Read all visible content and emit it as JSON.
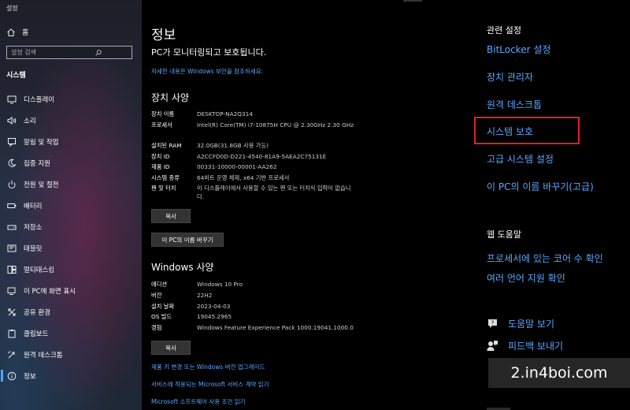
{
  "app_title": "설정",
  "home_label": "홈",
  "search_placeholder": "설정 검색",
  "section_label": "시스템",
  "nav": [
    {
      "label": "디스플레이",
      "icon": "display-icon"
    },
    {
      "label": "소리",
      "icon": "sound-icon"
    },
    {
      "label": "알림 및 작업",
      "icon": "notification-icon"
    },
    {
      "label": "집중 지원",
      "icon": "moon-icon"
    },
    {
      "label": "전원 및 절전",
      "icon": "power-icon"
    },
    {
      "label": "배터리",
      "icon": "battery-icon"
    },
    {
      "label": "저장소",
      "icon": "storage-icon"
    },
    {
      "label": "태블릿",
      "icon": "tablet-icon"
    },
    {
      "label": "멀티태스킹",
      "icon": "multitasking-icon"
    },
    {
      "label": "이 PC에 화면 표시",
      "icon": "project-icon"
    },
    {
      "label": "공유 환경",
      "icon": "share-icon"
    },
    {
      "label": "클립보드",
      "icon": "clipboard-icon"
    },
    {
      "label": "원격 데스크톱",
      "icon": "remote-icon"
    },
    {
      "label": "정보",
      "icon": "info-icon"
    }
  ],
  "main": {
    "title": "정보",
    "protected_text": "PC가 모니터링되고 보호됩니다.",
    "security_link": "자세한 내용은 Windows 보안을 참조하세요.",
    "device_heading": "장치 사양",
    "device_specs": [
      {
        "k": "장치 이름",
        "v": "DESKTOP-NA2Q314"
      },
      {
        "k": "프로세서",
        "v": "Intel(R) Core(TM) i7-10875H CPU @ 2.30GHz   2.30 GHz"
      },
      {
        "k": "설치된 RAM",
        "v": "32.0GB(31.8GB 사용 가능)"
      },
      {
        "k": "장치 ID",
        "v": "A2CCFD0D-D221-4540-81A9-5AEA2C75131E"
      },
      {
        "k": "제품 ID",
        "v": "00331-10000-00001-AA262"
      },
      {
        "k": "시스템 종류",
        "v": "64비트 운영 체제, x64 기반 프로세서"
      },
      {
        "k": "펜 및 터치",
        "v": "이 디스플레이에서 사용할 수 있는 펜 또는 터치식 입력이 없습니다."
      }
    ],
    "copy_label": "복사",
    "rename_label": "이 PC의 이름 바꾸기",
    "windows_heading": "Windows 사양",
    "windows_specs": [
      {
        "k": "에디션",
        "v": "Windows 10 Pro"
      },
      {
        "k": "버전",
        "v": "22H2"
      },
      {
        "k": "설치 날짜",
        "v": "2023-04-03"
      },
      {
        "k": "OS 빌드",
        "v": "19045.2965"
      },
      {
        "k": "경험",
        "v": "Windows Feature Experience Pack 1000.19041.1000.0"
      }
    ],
    "copy2_label": "복사",
    "links": [
      "제품 키 변경 또는 Windows 버전 업그레이드",
      "서비스에 적용되는 Microsoft 서비스 계약 읽기",
      "Microsoft 소프트웨어 사용 조건 읽기"
    ]
  },
  "related": {
    "heading": "관련 설정",
    "links": [
      "BitLocker 설정",
      "장치 관리자",
      "원격 데스크톱",
      "시스템 보호",
      "고급 시스템 설정",
      "이 PC의 이름 바꾸기(고급)"
    ]
  },
  "web_help": {
    "heading": "웹 도움말",
    "links": [
      "프로세서에 있는 코어 수 확인",
      "여러 언어 지원 확인"
    ]
  },
  "help": {
    "get_help": "도움말 보기",
    "feedback": "피드백 보내기"
  },
  "watermark": "2.in4boi.com",
  "colors": {
    "accent_link": "#5aa6ff",
    "highlight_box": "#e02020"
  }
}
